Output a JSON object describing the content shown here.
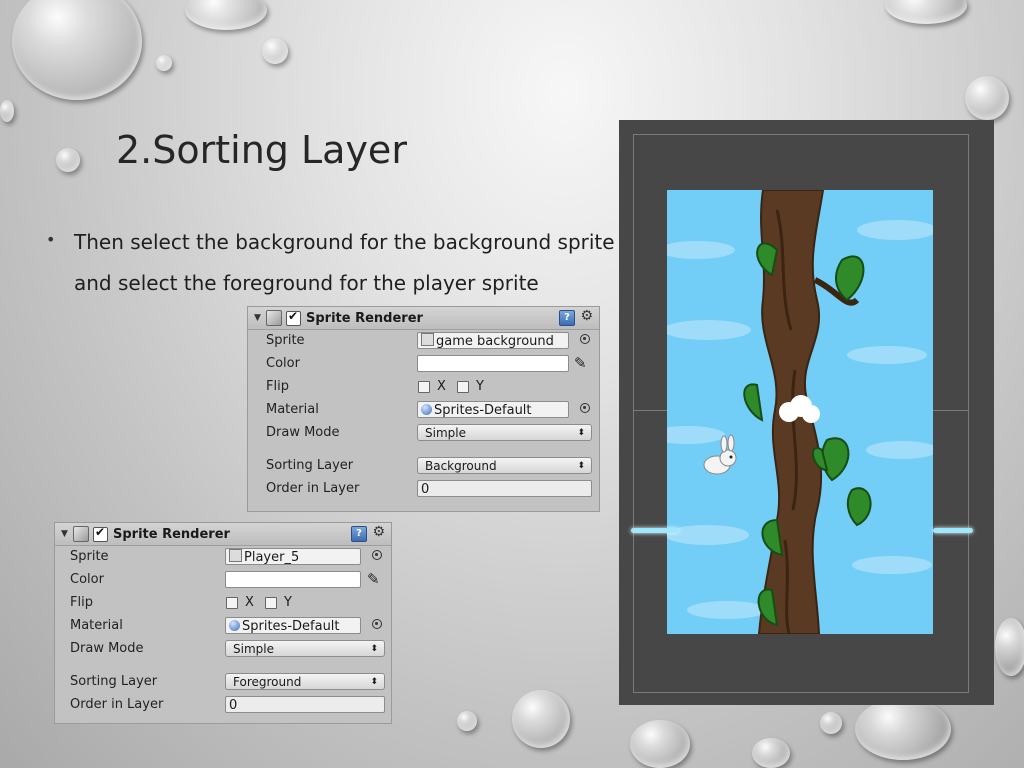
{
  "slide": {
    "title": "2.Sorting Layer",
    "bullet": "Then select the background for the background sprite and select the foreground for the player sprite"
  },
  "inspectors": [
    {
      "component": "Sprite Renderer",
      "fields": {
        "sprite_label": "Sprite",
        "sprite_value": "game background",
        "color_label": "Color",
        "flip_label": "Flip",
        "flip_x": "X",
        "flip_y": "Y",
        "material_label": "Material",
        "material_value": "Sprites-Default",
        "draw_mode_label": "Draw Mode",
        "draw_mode_value": "Simple",
        "sorting_layer_label": "Sorting Layer",
        "sorting_layer_value": "Background",
        "order_label": "Order in Layer",
        "order_value": "0"
      }
    },
    {
      "component": "Sprite Renderer",
      "fields": {
        "sprite_label": "Sprite",
        "sprite_value": "Player_5",
        "color_label": "Color",
        "flip_label": "Flip",
        "flip_x": "X",
        "flip_y": "Y",
        "material_label": "Material",
        "material_value": "Sprites-Default",
        "draw_mode_label": "Draw Mode",
        "draw_mode_value": "Simple",
        "sorting_layer_label": "Sorting Layer",
        "sorting_layer_value": "Foreground",
        "order_label": "Order in Layer",
        "order_value": "0"
      }
    }
  ],
  "colors": {
    "sky": "#72cdf7",
    "game_bg": "#474747",
    "inspector_bg": "#c2c2c2",
    "trunk": "#5a3a22",
    "leaf": "#2f8a2a"
  }
}
